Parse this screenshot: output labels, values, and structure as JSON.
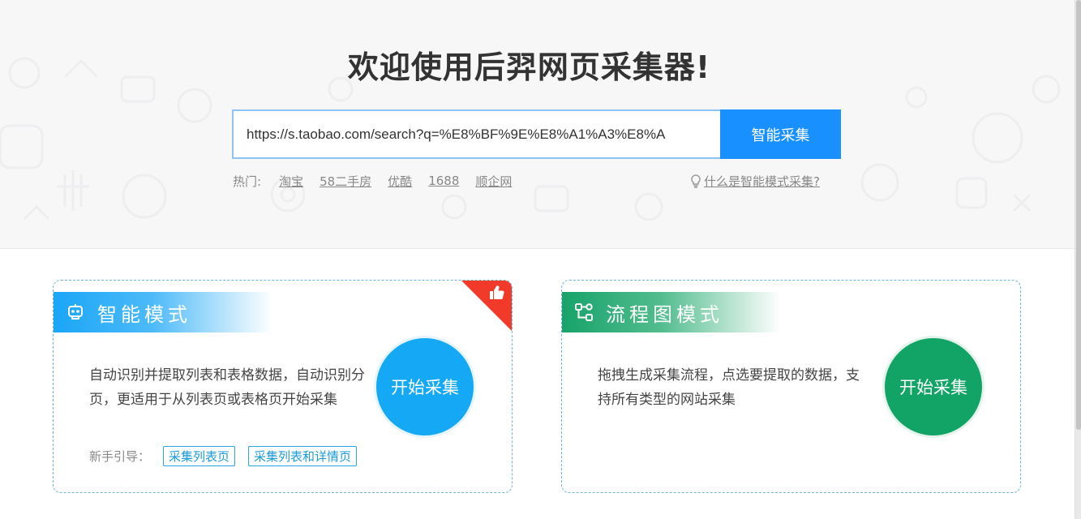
{
  "hero": {
    "title": "欢迎使用后羿网页采集器!",
    "search_value": "https://s.taobao.com/search?q=%E8%BF%9E%E8%A1%A3%E8%A",
    "search_button": "智能采集",
    "hot_label": "热门:",
    "hot_links": [
      "淘宝",
      "58二手房",
      "优酷",
      "1688",
      "顺企网"
    ],
    "help_link": "什么是智能模式采集?"
  },
  "cards": {
    "smart": {
      "title": "智能模式",
      "description": "自动识别并提取列表和表格数据，自动识别分页，更适用于从列表页或表格页开始采集",
      "start_button": "开始采集",
      "guide_label": "新手引导：",
      "guide_tags": [
        "采集列表页",
        "采集列表和详情页"
      ],
      "accent": "#14a8f5",
      "badge_color": "#f23a2a"
    },
    "flow": {
      "title": "流程图模式",
      "description": "拖拽生成采集流程，点选要提取的数据，支持所有类型的网站采集",
      "start_button": "开始采集",
      "accent": "#12a366"
    }
  },
  "icons": {
    "smart_header": "robot-icon",
    "flow_header": "flowchart-icon",
    "badge": "thumbs-up-icon",
    "help": "lightbulb-icon"
  }
}
